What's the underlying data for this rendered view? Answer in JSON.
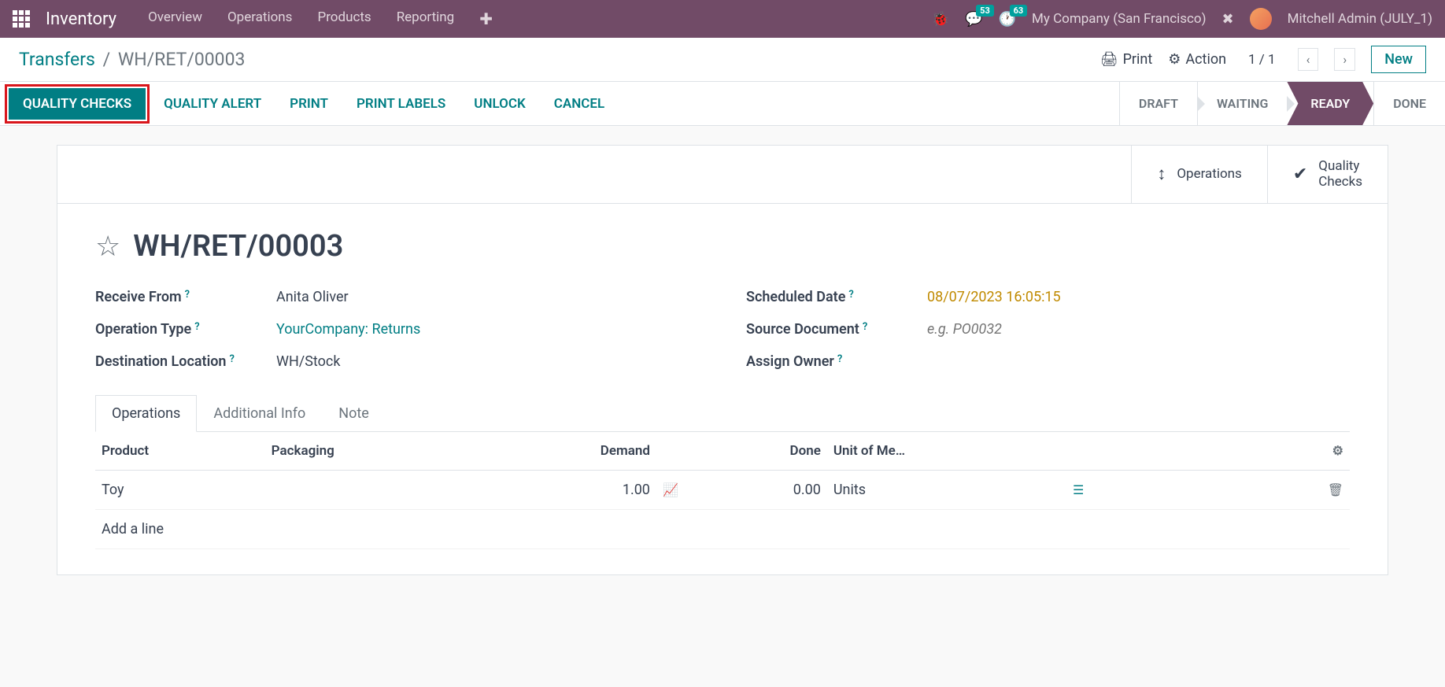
{
  "topbar": {
    "brand": "Inventory",
    "menu": [
      "Overview",
      "Operations",
      "Products",
      "Reporting"
    ],
    "chat_badge": "53",
    "clock_badge": "63",
    "company": "My Company (San Francisco)",
    "username": "Mitchell Admin (JULY_1)"
  },
  "breadcrumb": {
    "root": "Transfers",
    "current": "WH/RET/00003"
  },
  "subheader": {
    "print": "Print",
    "action": "Action",
    "pager": "1 / 1",
    "new": "New"
  },
  "actionbar": {
    "quality_checks": "QUALITY CHECKS",
    "quality_alert": "QUALITY ALERT",
    "print": "PRINT",
    "print_labels": "PRINT LABELS",
    "unlock": "UNLOCK",
    "cancel": "CANCEL"
  },
  "status": {
    "draft": "DRAFT",
    "waiting": "WAITING",
    "ready": "READY",
    "done": "DONE"
  },
  "stat_buttons": {
    "operations": "Operations",
    "quality_checks_l1": "Quality",
    "quality_checks_l2": "Checks"
  },
  "record": {
    "title": "WH/RET/00003",
    "fields": {
      "receive_from_label": "Receive From",
      "receive_from_value": "Anita Oliver",
      "operation_type_label": "Operation Type",
      "operation_type_value": "YourCompany: Returns",
      "destination_label": "Destination Location",
      "destination_value": "WH/Stock",
      "scheduled_date_label": "Scheduled Date",
      "scheduled_date_value": "08/07/2023 16:05:15",
      "source_doc_label": "Source Document",
      "source_doc_placeholder": "e.g. PO0032",
      "assign_owner_label": "Assign Owner"
    }
  },
  "tabs": {
    "operations": "Operations",
    "additional_info": "Additional Info",
    "note": "Note"
  },
  "table": {
    "headers": {
      "product": "Product",
      "packaging": "Packaging",
      "demand": "Demand",
      "done": "Done",
      "uom": "Unit of Me…"
    },
    "rows": [
      {
        "product": "Toy",
        "packaging": "",
        "demand": "1.00",
        "done": "0.00",
        "uom": "Units"
      }
    ],
    "add_line": "Add a line"
  }
}
